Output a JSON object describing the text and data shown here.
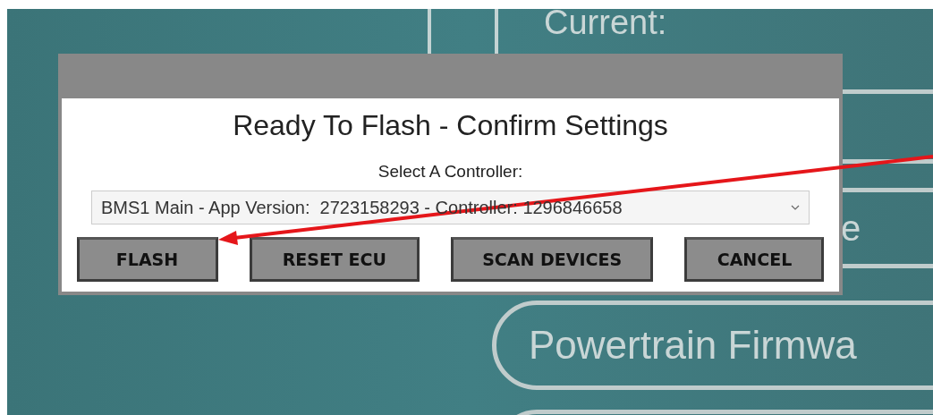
{
  "background": {
    "heading": "Current:",
    "pills": [
      {
        "label": "e"
      },
      {
        "label": "Powertrain Firmwa"
      }
    ]
  },
  "dialog": {
    "title": "Ready To Flash - Confirm Settings",
    "select_label": "Select A Controller:",
    "select_value": "BMS1 Main - App Version:  2723158293 - Controller: 1296846658",
    "buttons": [
      "FLASH",
      "RESET ECU",
      "SCAN DEVICES",
      "CANCEL"
    ]
  }
}
